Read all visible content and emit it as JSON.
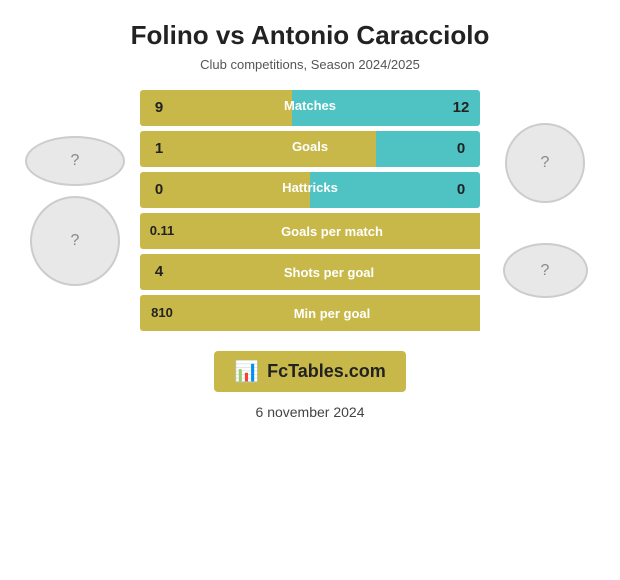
{
  "title": "Folino vs Antonio Caracciolo",
  "subtitle": "Club competitions, Season 2024/2025",
  "stats": [
    {
      "label": "Matches",
      "left_val": "9",
      "right_val": "12",
      "type": "two-sided",
      "left_pct": 43,
      "right_pct": 57
    },
    {
      "label": "Goals",
      "left_val": "1",
      "right_val": "0",
      "type": "two-sided",
      "left_pct": 80,
      "right_pct": 20
    },
    {
      "label": "Hattricks",
      "left_val": "0",
      "right_val": "0",
      "type": "two-sided",
      "left_pct": 50,
      "right_pct": 50
    },
    {
      "label": "Goals per match",
      "left_val": "0.11",
      "right_val": null,
      "type": "single"
    },
    {
      "label": "Shots per goal",
      "left_val": "4",
      "right_val": null,
      "type": "single"
    },
    {
      "label": "Min per goal",
      "left_val": "810",
      "right_val": null,
      "type": "single"
    }
  ],
  "logo": {
    "text": "FcTables.com",
    "icon": "📊"
  },
  "date": "6 november 2024"
}
